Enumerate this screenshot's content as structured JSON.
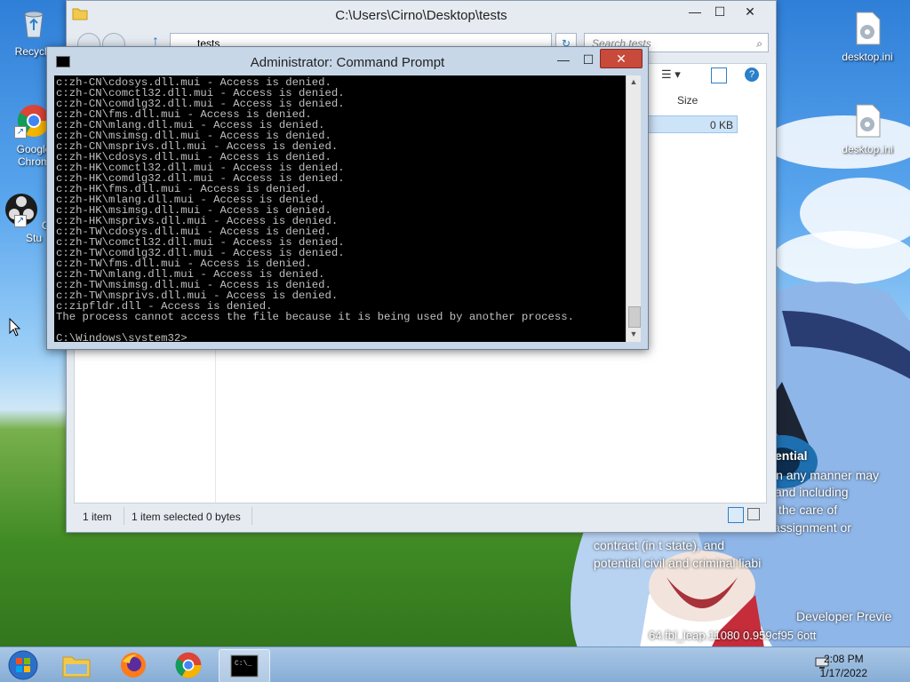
{
  "desktop": {
    "icons_left": [
      {
        "label": "Recycle",
        "name": "recycle-bin-icon"
      },
      {
        "label": "Google Chrom",
        "name": "chrome-icon"
      },
      {
        "label": "OBS Stu",
        "name": "obs-studio-icon"
      }
    ],
    "icons_right": [
      {
        "label": "desktop.ini",
        "name": "desktop-ini-file-icon"
      },
      {
        "label": "desktop.ini",
        "name": "desktop-ini-file-icon-2"
      }
    ],
    "watermark": {
      "heading": "ential",
      "lines": [
        "in any manner may",
        "and including",
        "the care of",
        "assignment or",
        "contract (in                    t state), and",
        "potential civil and criminal liabi"
      ],
      "build_title": "Developer Previe",
      "build_string": "64.fbl_leap.11080      0.959cf95        6ott"
    }
  },
  "explorer": {
    "title": "C:\\Users\\Cirno\\Desktop\\tests",
    "address": "tests",
    "search_placeholder": "Search tests",
    "column_size": "Size",
    "file_size": "0 KB",
    "status_items": "1 item",
    "status_selected": "1 item selected  0 bytes",
    "minimize": "—",
    "maximize": "☐",
    "close": "✕"
  },
  "cmd": {
    "title": "Administrator: Command Prompt",
    "minimize": "—",
    "maximize": "☐",
    "close": "✕",
    "lines": [
      "c:zh-CN\\cdosys.dll.mui - Access is denied.",
      "c:zh-CN\\comctl32.dll.mui - Access is denied.",
      "c:zh-CN\\comdlg32.dll.mui - Access is denied.",
      "c:zh-CN\\fms.dll.mui - Access is denied.",
      "c:zh-CN\\mlang.dll.mui - Access is denied.",
      "c:zh-CN\\msimsg.dll.mui - Access is denied.",
      "c:zh-CN\\msprivs.dll.mui - Access is denied.",
      "c:zh-HK\\cdosys.dll.mui - Access is denied.",
      "c:zh-HK\\comctl32.dll.mui - Access is denied.",
      "c:zh-HK\\comdlg32.dll.mui - Access is denied.",
      "c:zh-HK\\fms.dll.mui - Access is denied.",
      "c:zh-HK\\mlang.dll.mui - Access is denied.",
      "c:zh-HK\\msimsg.dll.mui - Access is denied.",
      "c:zh-HK\\msprivs.dll.mui - Access is denied.",
      "c:zh-TW\\cdosys.dll.mui - Access is denied.",
      "c:zh-TW\\comctl32.dll.mui - Access is denied.",
      "c:zh-TW\\comdlg32.dll.mui - Access is denied.",
      "c:zh-TW\\fms.dll.mui - Access is denied.",
      "c:zh-TW\\mlang.dll.mui - Access is denied.",
      "c:zh-TW\\msimsg.dll.mui - Access is denied.",
      "c:zh-TW\\msprivs.dll.mui - Access is denied.",
      "c:zipfldr.dll - Access is denied.",
      "The process cannot access the file because it is being used by another process.",
      "",
      "C:\\Windows\\system32>"
    ]
  },
  "taskbar": {
    "items": [
      {
        "name": "start-button",
        "label": "Start"
      },
      {
        "name": "file-explorer-taskbar-icon",
        "label": "File Explorer"
      },
      {
        "name": "firefox-taskbar-icon",
        "label": "Firefox"
      },
      {
        "name": "chrome-taskbar-icon",
        "label": "Google Chrome"
      },
      {
        "name": "command-prompt-taskbar-icon",
        "label": "Command Prompt"
      }
    ],
    "time": "2:08 PM",
    "date": "1/17/2022"
  }
}
